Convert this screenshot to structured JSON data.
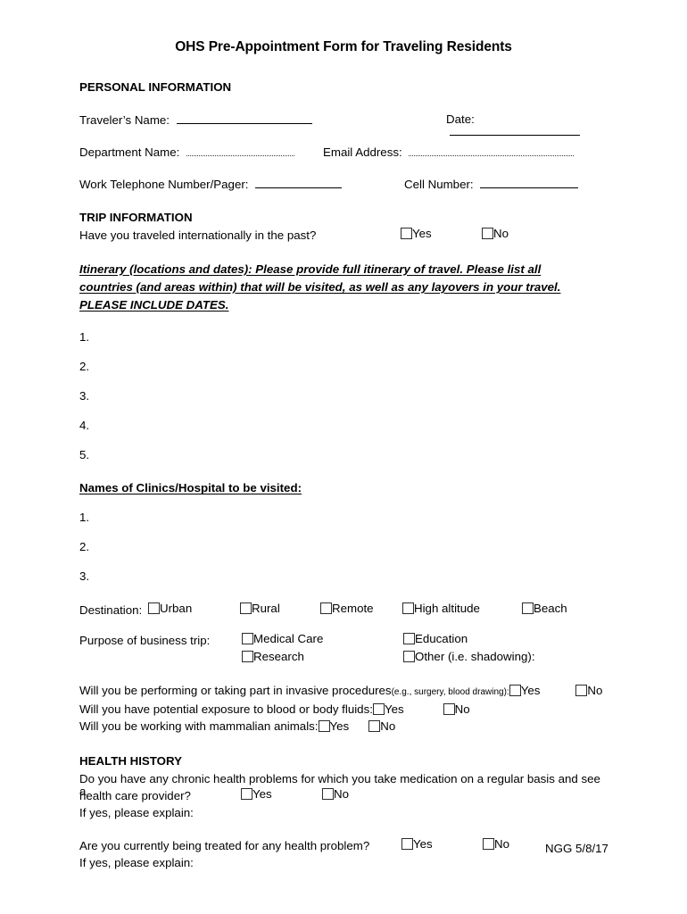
{
  "document": {
    "title": "OHS Pre-Appointment Form for Traveling Residents",
    "footer": "NGG 5/8/17"
  },
  "personal_information": {
    "heading": "PERSONAL INFORMATION",
    "fields": {
      "traveler_name_label": "Traveler’s Name:",
      "date_label": "Date:",
      "department_name_label": "Department Name:",
      "email_address_label": "Email Address:",
      "work_phone_label": "Work Telephone Number/Pager:",
      "cell_number_label": "Cell Number:"
    }
  },
  "trip_information": {
    "heading": "TRIP INFORMATION",
    "traveled_internationally": {
      "question": "Have you traveled internationally in the past?",
      "yes": "Yes",
      "no": "No"
    },
    "itinerary_instructions": "Itinerary (locations and dates): Please provide full itinerary of travel. Please list all countries (and areas within) that will be visited, as well as any layovers in your travel. PLEASE INCLUDE DATES.",
    "itinerary_items": [
      "1.",
      "2.",
      "3.",
      "4.",
      "5."
    ],
    "clinics_heading": "Names of Clinics/Hospital to be visited:",
    "clinics_items": [
      "1.",
      "2.",
      "3."
    ],
    "destination": {
      "label": "Destination:",
      "options": [
        "Urban",
        "Rural",
        "Remote",
        "High altitude",
        "Beach"
      ]
    },
    "purpose": {
      "label": "Purpose of business trip:",
      "options": [
        "Medical Care",
        "Education",
        "Research",
        "Other (i.e. shadowing):"
      ]
    },
    "invasive_procedures": {
      "question": "Will you be performing or taking part in invasive procedures",
      "note": "(e.g., surgery, blood drawing):",
      "yes": "Yes",
      "no": "No"
    },
    "blood_exposure": {
      "question": "Will you have potential exposure to blood or body fluids:",
      "yes": "Yes",
      "no": "No"
    },
    "mammalian_animals": {
      "question": "Will you be working with mammalian animals:",
      "yes": "Yes",
      "no": "No"
    }
  },
  "health_history": {
    "heading": "HEALTH HISTORY",
    "chronic_problems": {
      "question_line1": "Do you have any chronic health problems for which you take medication on a regular basis and see a",
      "question_line2": "health care provider?",
      "yes": "Yes",
      "no": "No",
      "explain": "If yes, please explain:"
    },
    "current_treatment": {
      "question": "Are you currently being treated for any health problem?",
      "yes": "Yes",
      "no": "No",
      "explain": "If yes, please explain:"
    }
  }
}
